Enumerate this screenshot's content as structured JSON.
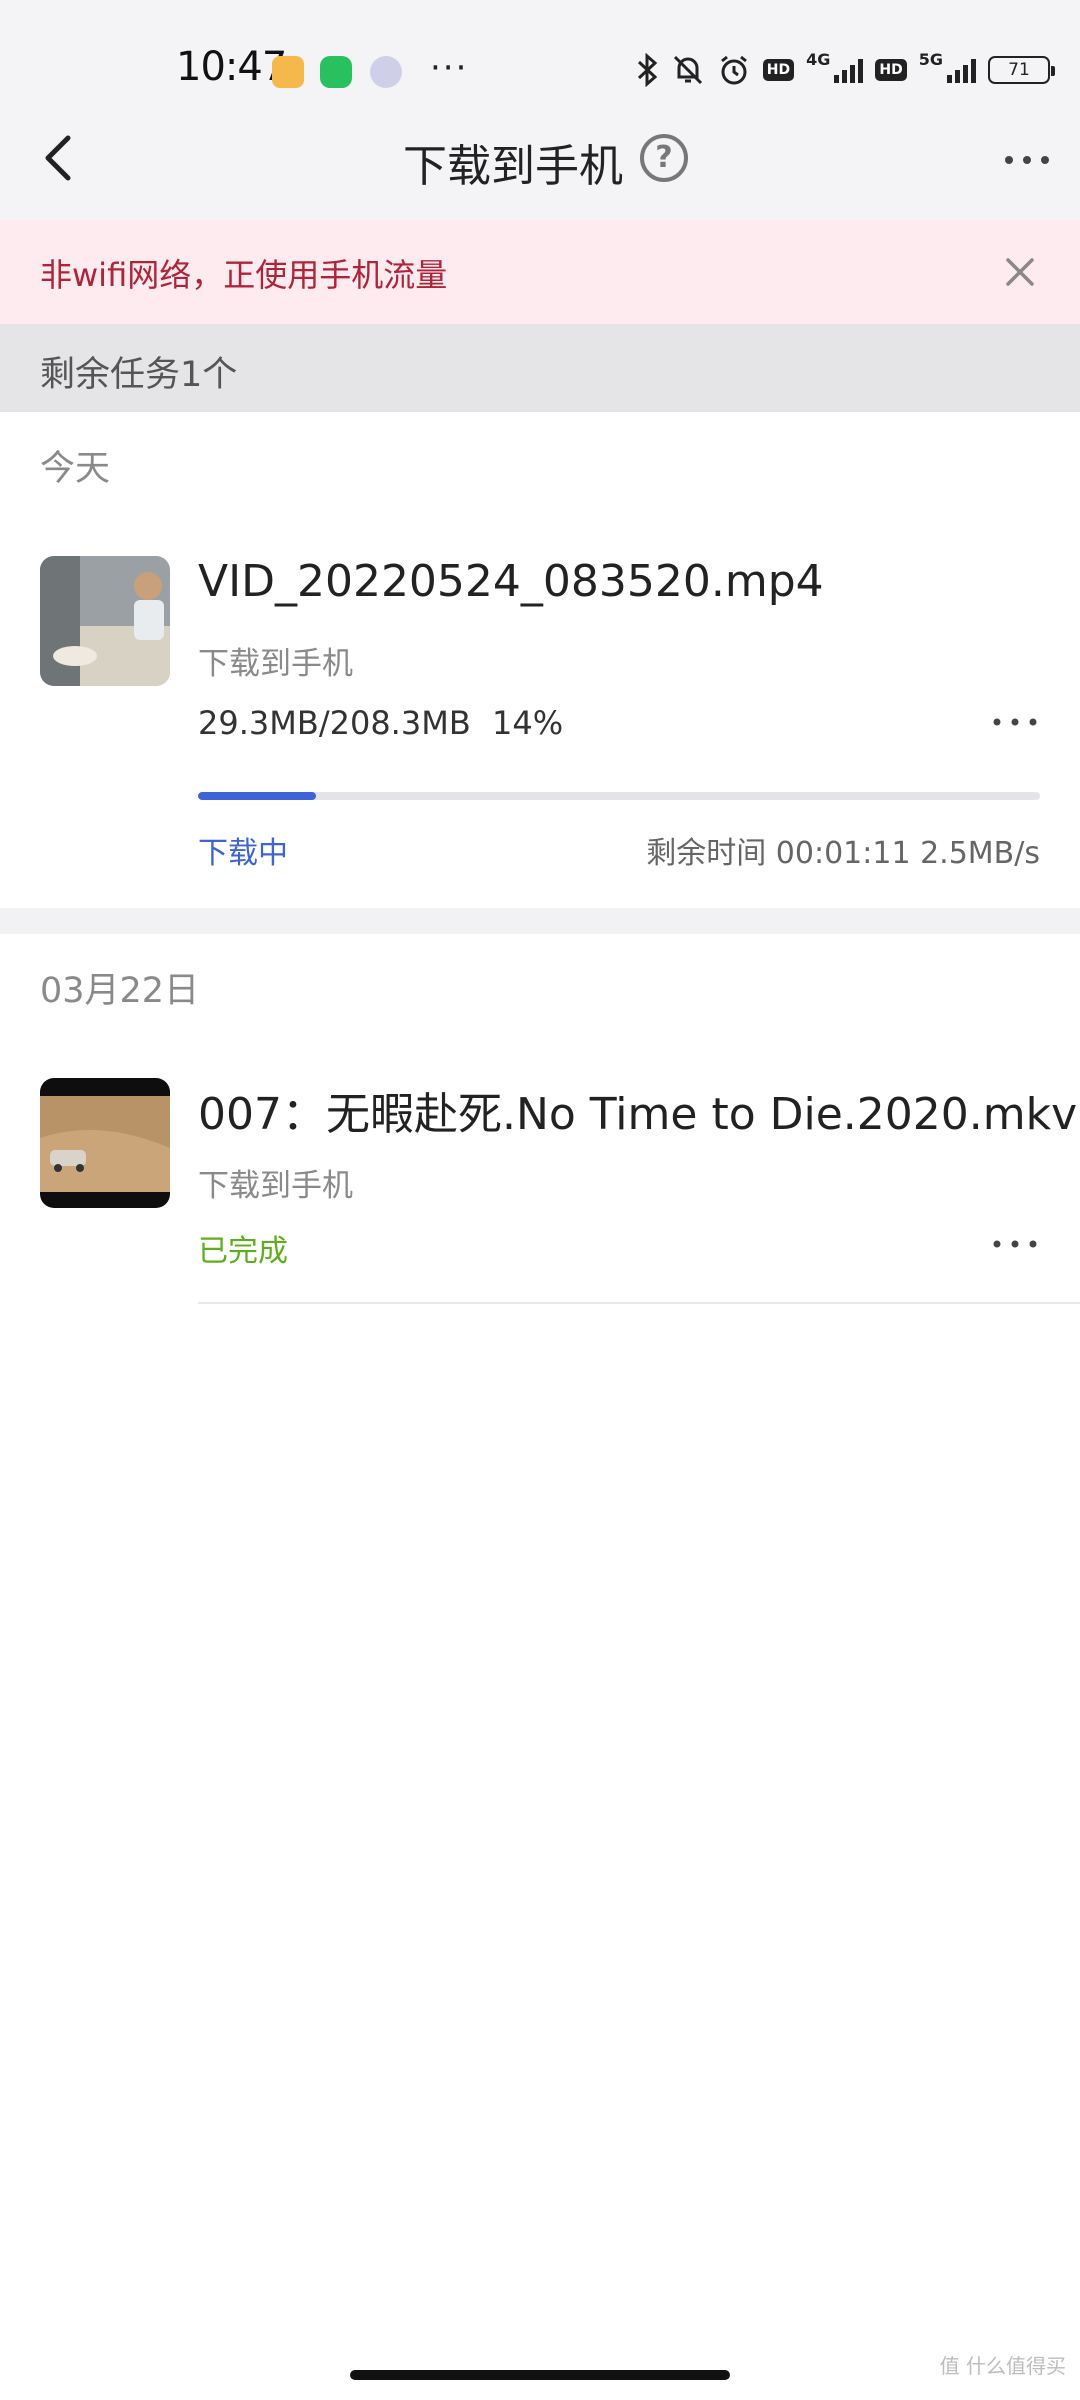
{
  "status_bar": {
    "time": "10:47",
    "net_1": "4G",
    "net_2": "5G",
    "hd": "HD",
    "battery": "71",
    "icons": [
      "notification-app-icon",
      "wechat-icon",
      "camera-app-icon",
      "bluetooth-icon",
      "mute-bell-icon",
      "alarm-icon",
      "signal-icon",
      "battery-icon"
    ]
  },
  "header": {
    "title": "下载到手机",
    "help": "?"
  },
  "notice": {
    "text": "非wifi网络，正使用手机流量"
  },
  "tasks_bar": {
    "text": "剩余任务1个"
  },
  "groups": [
    {
      "label": "今天",
      "item": {
        "name": "VID_20220524_083520.mp4",
        "destination": "下载到手机",
        "size": "29.3MB/208.3MB",
        "percent_text": "14%",
        "progress": 0.14,
        "state": "下载中",
        "remaining": "剩余时间 00:01:11 2.5MB/s"
      }
    },
    {
      "label": "03月22日",
      "item": {
        "name": "007：无暇赴死.No Time to Die.2020.mkv",
        "destination": "下载到手机",
        "state": "已完成"
      }
    }
  ],
  "watermark": "值 什么值得买",
  "colors": {
    "accent": "#3e63d6",
    "done": "#5fae1e",
    "notice_bg": "#fdebef",
    "notice_text": "#b0243a"
  }
}
